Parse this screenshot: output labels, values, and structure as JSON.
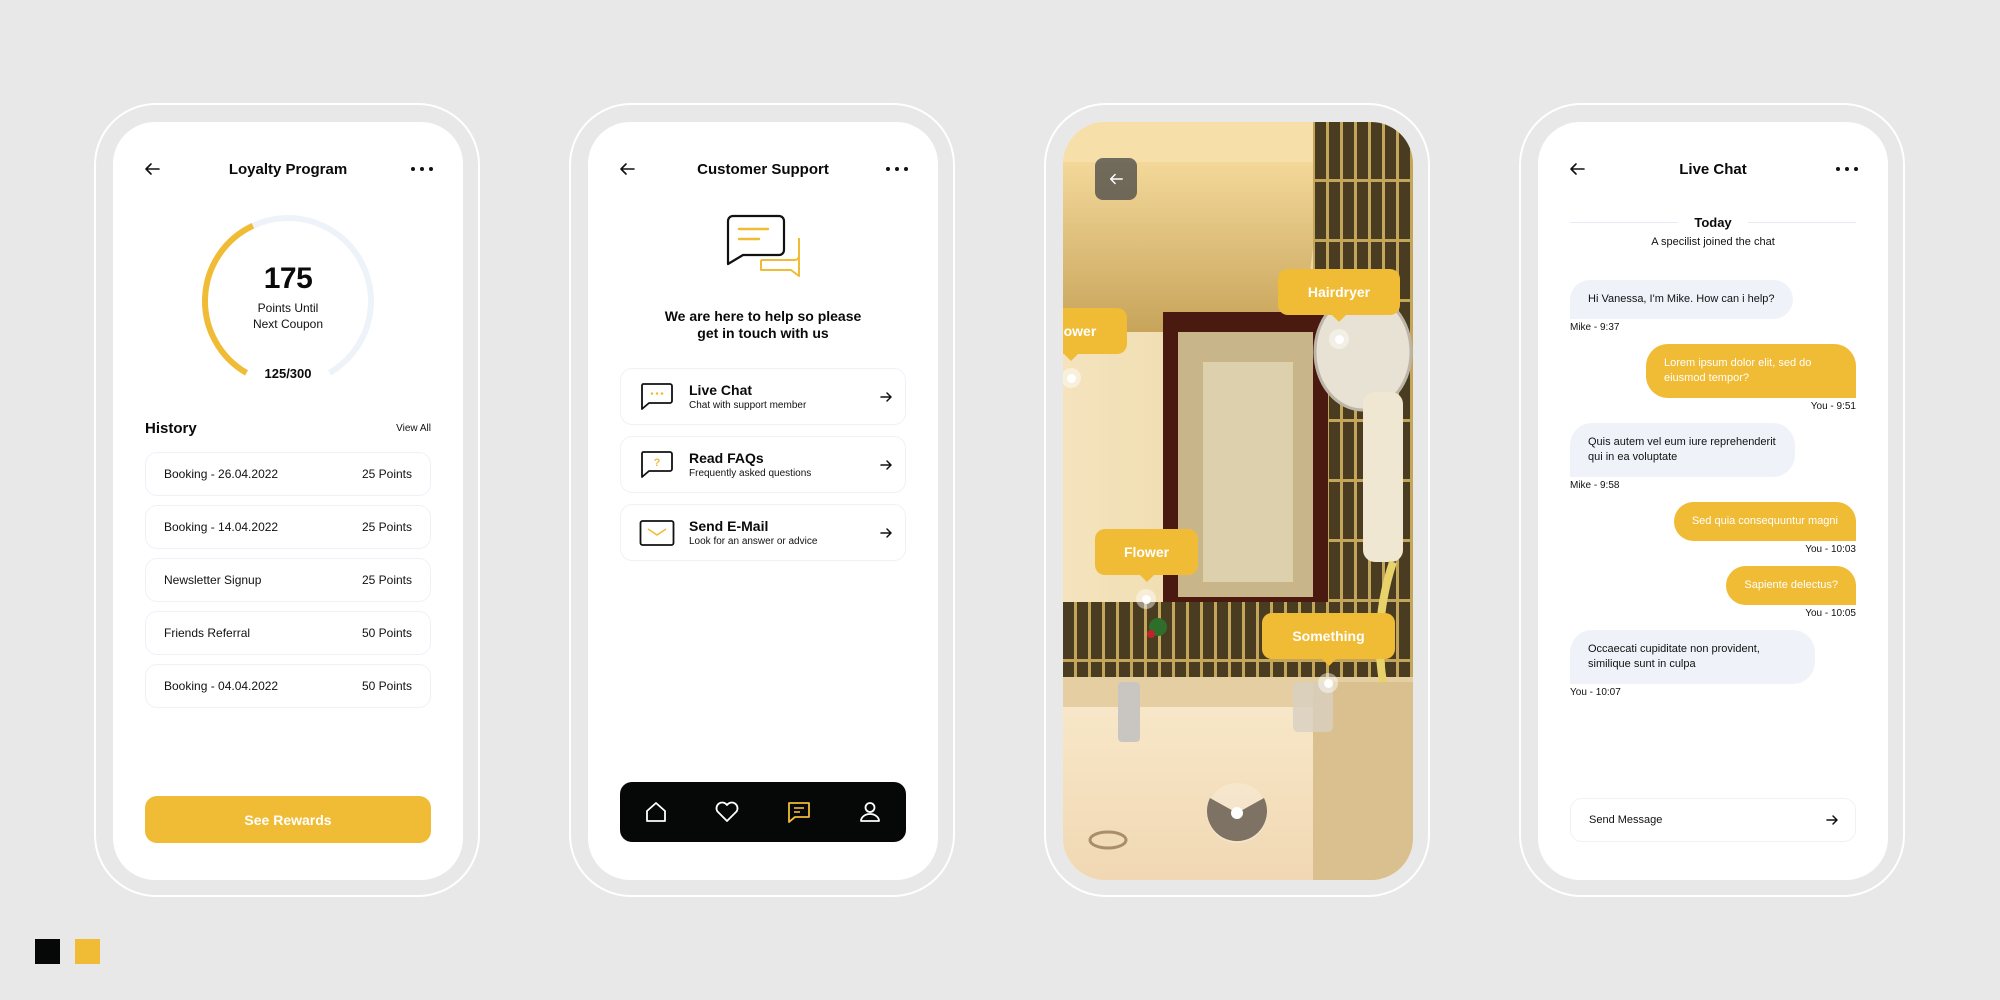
{
  "colors": {
    "background": "#e7e8e7",
    "accent": "#f0bb35",
    "dark": "#060808",
    "bubble_in": "#eff3f9",
    "track": "#eef3f9"
  },
  "loyalty": {
    "title": "Loyalty Program",
    "points_until_coupon": "175",
    "caption_line1": "Points Until",
    "caption_line2": "Next Coupon",
    "progress_text": "125/300",
    "progress": {
      "current": 125,
      "total": 300
    },
    "history_title": "History",
    "view_all": "View All",
    "history": [
      {
        "label": "Booking - 26.04.2022",
        "points": "25 Points"
      },
      {
        "label": "Booking - 14.04.2022",
        "points": "25 Points"
      },
      {
        "label": "Newsletter Signup",
        "points": "25 Points"
      },
      {
        "label": "Friends Referral",
        "points": "50 Points"
      },
      {
        "label": "Booking - 04.04.2022",
        "points": "50 Points"
      }
    ],
    "cta": "See Rewards"
  },
  "support": {
    "title": "Customer Support",
    "headline_line1": "We are here to help so please",
    "headline_line2": "get in touch with us",
    "options": [
      {
        "title": "Live Chat",
        "subtitle": "Chat with support member",
        "icon": "chat-dots-icon"
      },
      {
        "title": "Read FAQs",
        "subtitle": "Frequently asked questions",
        "icon": "question-bubble-icon"
      },
      {
        "title": "Send E-Mail",
        "subtitle": "Look for an answer or advice",
        "icon": "envelope-icon"
      }
    ],
    "nav": [
      {
        "name": "home",
        "icon": "home-icon",
        "active": false
      },
      {
        "name": "favorites",
        "icon": "heart-icon",
        "active": false
      },
      {
        "name": "messages",
        "icon": "message-icon",
        "active": true
      },
      {
        "name": "profile",
        "icon": "user-icon",
        "active": false
      }
    ]
  },
  "camera": {
    "hotspots": [
      {
        "label": "Shower"
      },
      {
        "label": "Hairdryer"
      },
      {
        "label": "Flower"
      },
      {
        "label": "Something"
      }
    ]
  },
  "chat": {
    "title": "Live Chat",
    "day": "Today",
    "system_note": "A specilist joined the chat",
    "messages": [
      {
        "dir": "in",
        "text": "Hi Vanessa, I'm Mike. How can i help?",
        "meta": "Mike - 9:37"
      },
      {
        "dir": "out",
        "text": "Lorem ipsum dolor elit, sed do eiusmod tempor?",
        "meta": "You - 9:51"
      },
      {
        "dir": "in",
        "text": "Quis autem vel eum iure reprehenderit qui in ea voluptate",
        "meta": "Mike - 9:58"
      },
      {
        "dir": "out",
        "text": "Sed quia consequuntur magni",
        "meta": "You - 10:03"
      },
      {
        "dir": "out",
        "text": "Sapiente delectus?",
        "meta": "You - 10:05"
      },
      {
        "dir": "in",
        "text": "Occaecati cupiditate non provident, similique sunt in culpa",
        "meta": "You - 10:07"
      }
    ],
    "composer_placeholder": "Send Message"
  },
  "swatches": [
    "#060808",
    "#f0bb35"
  ]
}
